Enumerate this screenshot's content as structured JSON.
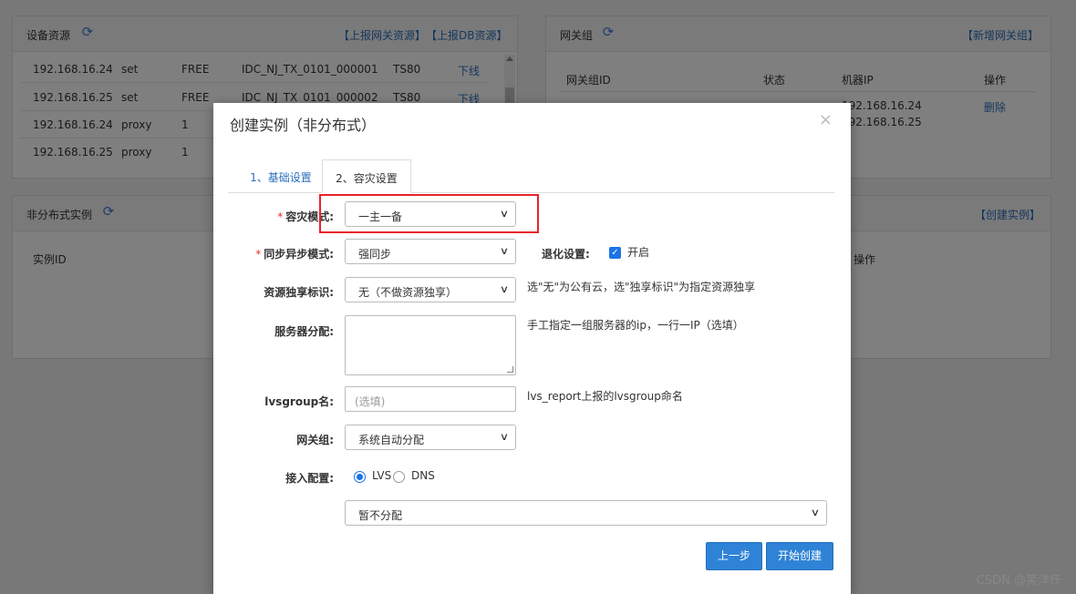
{
  "device_panel": {
    "title": "设备资源",
    "links": [
      "【上报网关资源】",
      "【上报DB资源】"
    ],
    "rows": [
      {
        "ip": "192.168.16.24",
        "type": "set",
        "status": "FREE",
        "idc": "IDC_NJ_TX_0101_000001",
        "model": "TS80",
        "action": "下线"
      },
      {
        "ip": "192.168.16.25",
        "type": "set",
        "status": "FREE",
        "idc": "IDC_NJ_TX_0101_000002",
        "model": "TS80",
        "action": "下线"
      },
      {
        "ip": "192.168.16.24",
        "type": "proxy",
        "status": "1",
        "idc": "",
        "model": "",
        "action": ""
      },
      {
        "ip": "192.168.16.25",
        "type": "proxy",
        "status": "1",
        "idc": "",
        "model": "",
        "action": ""
      }
    ]
  },
  "gateway_panel": {
    "title": "网关组",
    "link": "【新增网关组】",
    "headers": [
      "网关组ID",
      "状态",
      "机器IP",
      "操作"
    ],
    "row": {
      "ip1": "192.168.16.24",
      "ip2": "192.168.16.25",
      "action": "删除"
    }
  },
  "instance_panel": {
    "title": "非分布式实例",
    "link": "【创建实例】",
    "col_id": "实例ID",
    "col_op": "操作"
  },
  "modal": {
    "title": "创建实例（非分布式）",
    "close": "×",
    "tabs": [
      "1、基础设置",
      "2、容灾设置"
    ],
    "fields": {
      "dr_mode": {
        "label": "容灾模式:",
        "value": "一主一备"
      },
      "sync_mode": {
        "label": "同步异步模式:",
        "value": "强同步"
      },
      "degrade": {
        "label": "退化设置:",
        "option": "开启"
      },
      "resource_exclusive": {
        "label": "资源独享标识:",
        "value": "无（不做资源独享）",
        "hint": "选\"无\"为公有云，选\"独享标识\"为指定资源独享"
      },
      "server_alloc": {
        "label": "服务器分配:",
        "hint": "手工指定一组服务器的ip，一行一IP（选填）"
      },
      "lvsgroup": {
        "label": "lvsgroup名:",
        "placeholder": "(选填)",
        "hint": "lvs_report上报的lvsgroup命名"
      },
      "gateway_group": {
        "label": "网关组:",
        "value": "系统自动分配"
      },
      "access": {
        "label": "接入配置:",
        "options": [
          "LVS",
          "DNS"
        ],
        "value": "暂不分配"
      }
    },
    "buttons": {
      "prev": "上一步",
      "create": "开始创建"
    }
  },
  "watermark": "CSDN @笑洋仟",
  "colors": {
    "accent": "#2f83d6",
    "link": "#2a6ebd",
    "highlight": "#e8232a"
  }
}
